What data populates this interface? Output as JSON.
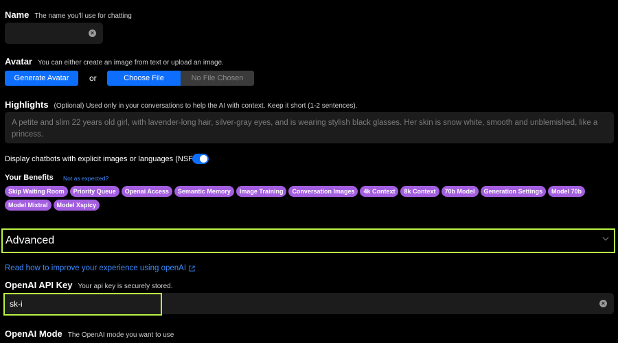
{
  "name": {
    "title": "Name",
    "hint": "The name you'll use for chatting",
    "value": ""
  },
  "avatar": {
    "title": "Avatar",
    "hint": "You can either create an image from text or upload an image.",
    "generate_label": "Generate Avatar",
    "or_label": "or",
    "choose_label": "Choose File",
    "file_status": "No File Chosen"
  },
  "highlights": {
    "title": "Highlights",
    "hint": "(Optional) Used only in your conversations to help the AI with context. Keep it short (1-2 sentences).",
    "placeholder": "A petite and slim 22 years old girl, with lavender-long hair, silver-gray eyes, and is wearing stylish black glasses. Her skin is snow white, smooth and unblemished, like a princess."
  },
  "nsfw": {
    "label": "Display chatbots with explicit images or languages (NSFW)",
    "enabled": true
  },
  "benefits": {
    "title": "Your Benefits",
    "link_label": "Not as expected?",
    "tags": [
      "Skip Waiting Room",
      "Priority Queue",
      "Openai Access",
      "Semantic Memory",
      "Image Training",
      "Conversation Images",
      "4k Context",
      "8k Context",
      "70b Model",
      "Generation Settings",
      "Model 70b",
      "Model Mixtral",
      "Model Xspicy"
    ]
  },
  "advanced": {
    "title": "Advanced",
    "chevron": "chevron-down-icon"
  },
  "openai": {
    "improve_link": "Read how to improve your experience using openAI",
    "api_key_title": "OpenAI API Key",
    "api_key_hint": "Your api key is securely stored.",
    "api_key_value": "sk-i",
    "mode_title": "OpenAI Mode",
    "mode_hint": "The OpenAI mode you want to use"
  },
  "colors": {
    "background": "#000000",
    "input_bg": "#1c1c1c",
    "primary": "#0d6efd",
    "tag": "#a35ee0",
    "highlight_border": "#b9f545",
    "link": "#3d8bfd"
  }
}
